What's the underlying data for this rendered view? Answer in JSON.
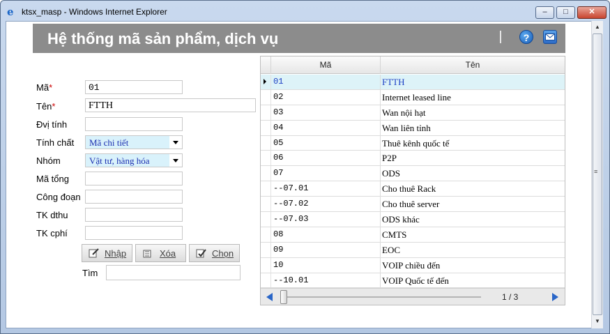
{
  "window": {
    "title": "ktsx_masp - Windows Internet Explorer",
    "min_label": "‒",
    "max_label": "□",
    "close_label": "✕"
  },
  "header": {
    "title": "Hệ thống mã sản phẩm, dịch vụ",
    "help_icon": "?"
  },
  "form": {
    "ma": {
      "label": "Mã",
      "required": "*",
      "value": "01"
    },
    "ten": {
      "label": "Tên",
      "required": "*",
      "value": "FTTH"
    },
    "dvi_tinh": {
      "label": "Đvị tính",
      "value": ""
    },
    "tinh_chat": {
      "label": "Tính chất",
      "value": "Mã chi tiết"
    },
    "nhom": {
      "label": "Nhóm",
      "value": "Vật tư, hàng hóa"
    },
    "ma_tong": {
      "label": "Mã tổng",
      "value": ""
    },
    "cong_doan": {
      "label": "Công đoạn",
      "value": ""
    },
    "tk_dthu": {
      "label": "TK dthu",
      "value": ""
    },
    "tk_cphi": {
      "label": "TK cphí",
      "value": ""
    },
    "tim": {
      "label": "Tìm",
      "value": ""
    }
  },
  "buttons": {
    "nhap": "Nhập",
    "xoa": "Xóa",
    "chon": "Chọn"
  },
  "grid": {
    "columns": [
      "Mã",
      "Tên"
    ],
    "rows": [
      {
        "ma": "01",
        "ten": "FTTH"
      },
      {
        "ma": "02",
        "ten": "Internet leased line"
      },
      {
        "ma": "03",
        "ten": "Wan nội hạt"
      },
      {
        "ma": "04",
        "ten": "Wan liên tỉnh"
      },
      {
        "ma": "05",
        "ten": "Thuê kênh quốc tế"
      },
      {
        "ma": "06",
        "ten": "P2P"
      },
      {
        "ma": "07",
        "ten": "ODS"
      },
      {
        "ma": "--07.01",
        "ten": "Cho thuê Rack"
      },
      {
        "ma": "--07.02",
        "ten": "Cho thuê server"
      },
      {
        "ma": "--07.03",
        "ten": "ODS khác"
      },
      {
        "ma": "08",
        "ten": "CMTS"
      },
      {
        "ma": "09",
        "ten": "EOC"
      },
      {
        "ma": "10",
        "ten": "VOIP chiều đến"
      },
      {
        "ma": "--10.01",
        "ten": "VOIP Quốc tế đến"
      }
    ],
    "selected_row": 0,
    "pager": "1 / 3"
  },
  "colors": {
    "header_bg": "#8c8c8c",
    "selected_row": "#ddf3f8",
    "select_bg": "#d9f2fb",
    "accent_blue": "#2a66c8"
  }
}
